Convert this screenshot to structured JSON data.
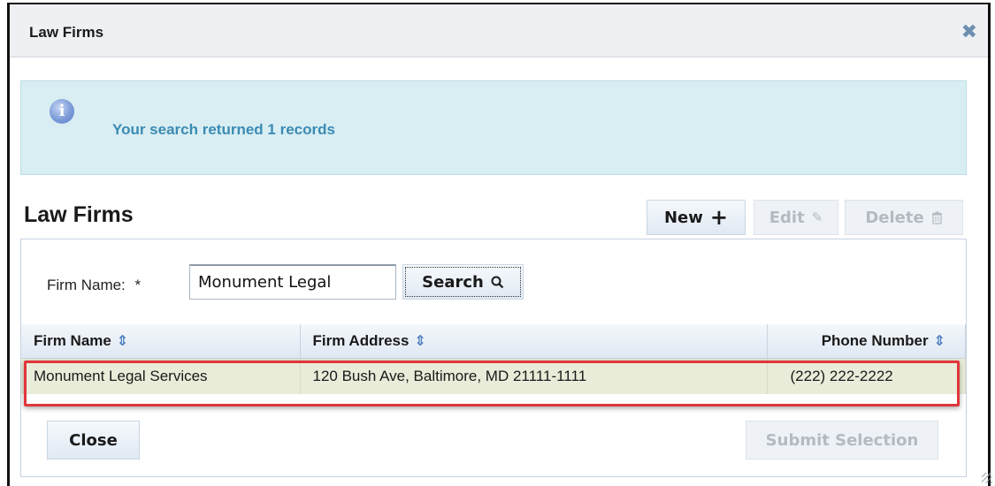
{
  "dialog": {
    "title": "Law Firms",
    "close_icon": "close-icon"
  },
  "info": {
    "icon": "info-icon",
    "message": "Your search returned 1 records"
  },
  "section": {
    "title": "Law Firms"
  },
  "toolbar": {
    "new_label": "New",
    "new_icon": "plus-icon",
    "edit_label": "Edit",
    "edit_icon": "edit-icon",
    "delete_label": "Delete",
    "delete_icon": "trash-icon"
  },
  "search": {
    "label": "Firm Name:",
    "required_mark": "*",
    "value": "Monument Legal",
    "button_label": "Search",
    "button_icon": "search-icon"
  },
  "table": {
    "columns": [
      "Firm Name",
      "Firm Address",
      "Phone Number"
    ],
    "rows": [
      [
        "Monument Legal Services",
        "120 Bush Ave, Baltimore, MD 21111-1111",
        "(222) 222-2222"
      ]
    ]
  },
  "footer": {
    "close_label": "Close",
    "submit_label": "Submit Selection"
  },
  "colors": {
    "info_background": "#d8eef3",
    "info_text": "#3b8bb3",
    "selected_row": "#e9ecd8",
    "highlight_border": "#e0363c"
  }
}
